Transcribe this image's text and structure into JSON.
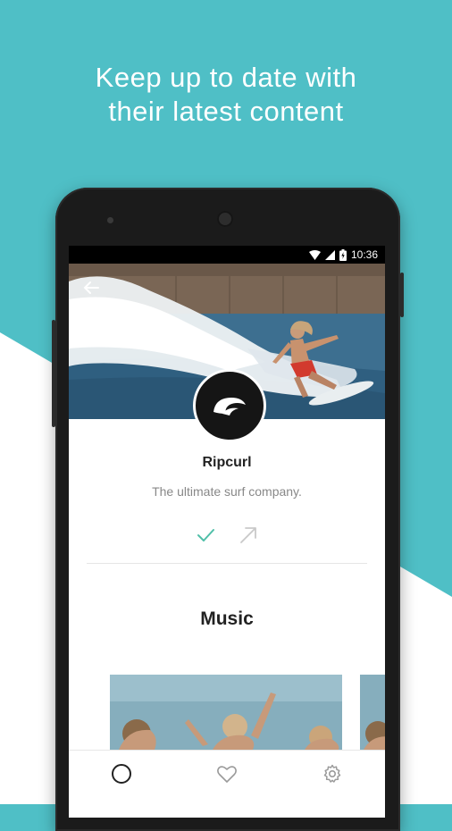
{
  "promo": {
    "headline_line1": "Keep up to date with",
    "headline_line2": "their latest content"
  },
  "statusbar": {
    "time": "10:36",
    "icons": [
      "wifi-icon",
      "signal-icon",
      "battery-icon"
    ]
  },
  "header": {
    "back_icon": "back-arrow-icon"
  },
  "profile": {
    "name": "Ripcurl",
    "description": "The ultimate surf company.",
    "logo": "ripcurl-wave-logo"
  },
  "actions": {
    "follow_icon": "check-icon",
    "share_icon": "share-arrow-icon",
    "accent_color": "#4fbfa8"
  },
  "section": {
    "title": "Music"
  },
  "bottom_nav": {
    "items": [
      "home-circle-icon",
      "heart-icon",
      "settings-gear-icon"
    ]
  },
  "colors": {
    "background_teal": "#4fbfc6",
    "phone_body": "#1b1b1b"
  }
}
